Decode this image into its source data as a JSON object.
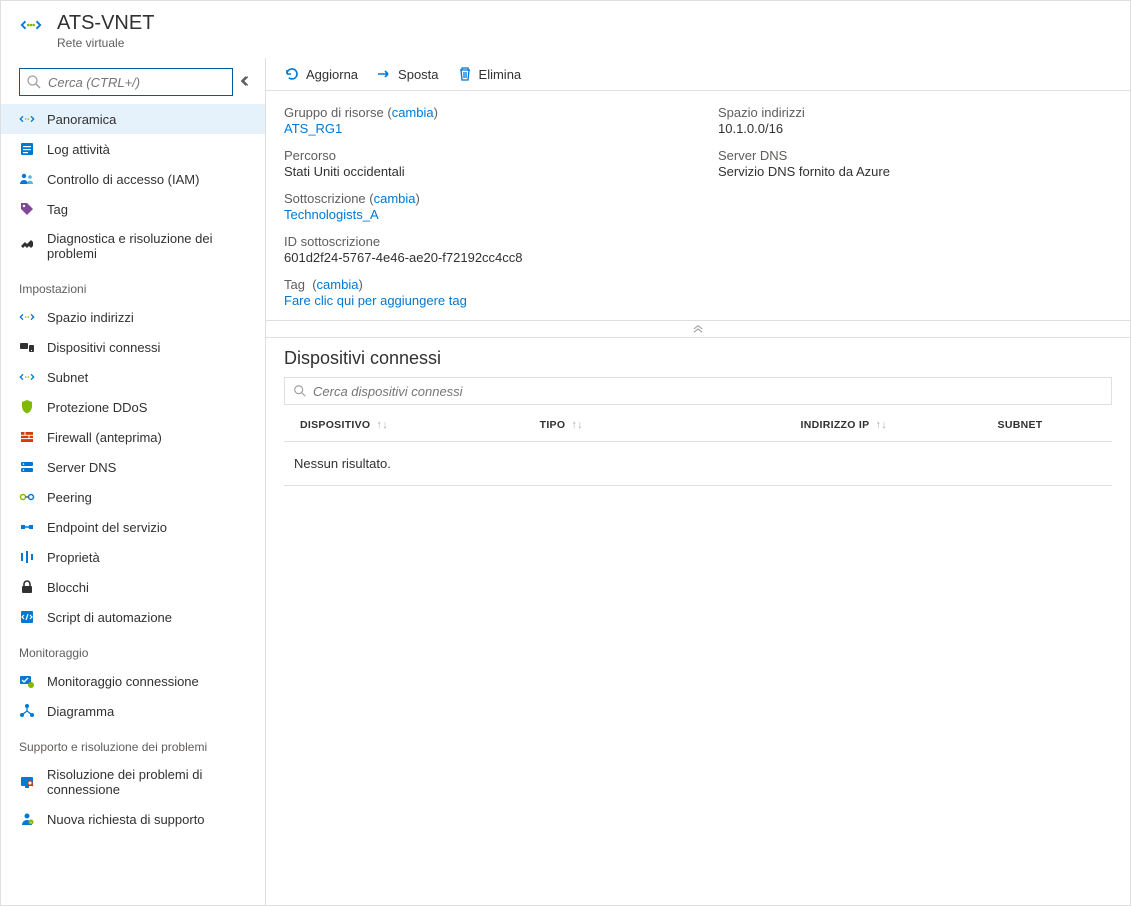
{
  "header": {
    "title": "ATS-VNET",
    "subtitle": "Rete virtuale"
  },
  "sidebar": {
    "search_placeholder": "Cerca (CTRL+/)",
    "items_top": [
      {
        "label": "Panoramica",
        "icon": "vnet-icon",
        "active": true
      },
      {
        "label": "Log attività",
        "icon": "activity-log-icon"
      },
      {
        "label": "Controllo di accesso (IAM)",
        "icon": "iam-icon"
      },
      {
        "label": "Tag",
        "icon": "tag-icon"
      },
      {
        "label": "Diagnostica e risoluzione dei problemi",
        "icon": "diagnose-icon"
      }
    ],
    "section_settings": "Impostazioni",
    "items_settings": [
      {
        "label": "Spazio indirizzi",
        "icon": "vnet-icon"
      },
      {
        "label": "Dispositivi connessi",
        "icon": "devices-icon"
      },
      {
        "label": "Subnet",
        "icon": "vnet-icon"
      },
      {
        "label": "Protezione DDoS",
        "icon": "shield-icon"
      },
      {
        "label": "Firewall (anteprima)",
        "icon": "firewall-icon"
      },
      {
        "label": "Server DNS",
        "icon": "dns-icon"
      },
      {
        "label": "Peering",
        "icon": "peering-icon"
      },
      {
        "label": "Endpoint del servizio",
        "icon": "endpoint-icon"
      },
      {
        "label": "Proprietà",
        "icon": "properties-icon"
      },
      {
        "label": "Blocchi",
        "icon": "lock-icon"
      },
      {
        "label": "Script di automazione",
        "icon": "script-icon"
      }
    ],
    "section_monitoring": "Monitoraggio",
    "items_monitoring": [
      {
        "label": "Monitoraggio connessione",
        "icon": "connection-monitor-icon"
      },
      {
        "label": "Diagramma",
        "icon": "diagram-icon"
      }
    ],
    "section_support": "Supporto e risoluzione dei problemi",
    "items_support": [
      {
        "label": "Risoluzione dei problemi di connessione",
        "icon": "troubleshoot-icon"
      },
      {
        "label": "Nuova richiesta di supporto",
        "icon": "support-icon"
      }
    ]
  },
  "toolbar": {
    "refresh_label": "Aggiorna",
    "move_label": "Sposta",
    "delete_label": "Elimina"
  },
  "overview": {
    "resource_group_label": "Gruppo di risorse",
    "resource_group_value": "ATS_RG1",
    "change_text": "cambia",
    "location_label": "Percorso",
    "location_value": "Stati Uniti occidentali",
    "subscription_label": "Sottoscrizione",
    "subscription_value": "Technologists_A",
    "subscription_id_label": "ID sottoscrizione",
    "subscription_id_value": "601d2f24-5767-4e46-ae20-f72192cc4cc8",
    "tags_label": "Tag",
    "tags_add_text": "Fare clic qui per aggiungere tag",
    "address_space_label": "Spazio indirizzi",
    "address_space_value": "10.1.0.0/16",
    "dns_label": "Server DNS",
    "dns_value": "Servizio DNS fornito da Azure"
  },
  "devices": {
    "heading": "Dispositivi connessi",
    "search_placeholder": "Cerca dispositivi connessi",
    "columns": {
      "device": "DISPOSITIVO",
      "type": "TIPO",
      "ip": "INDIRIZZO IP",
      "subnet": "SUBNET"
    },
    "no_results": "Nessun risultato."
  }
}
